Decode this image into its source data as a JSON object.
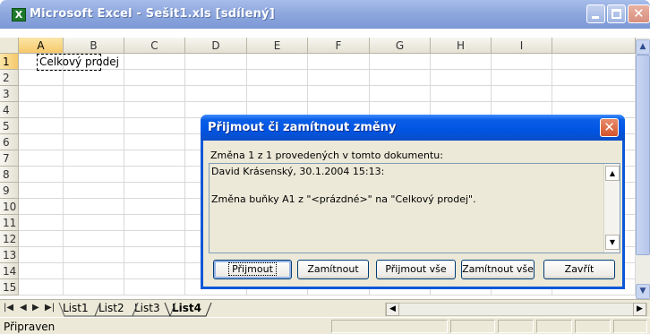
{
  "window": {
    "title": "Microsoft Excel - Sešit1.xls  [sdílený]"
  },
  "grid": {
    "columns": [
      "A",
      "B",
      "C",
      "D",
      "E",
      "F",
      "G",
      "H",
      "I"
    ],
    "rows": [
      "1",
      "2",
      "3",
      "4",
      "5",
      "6",
      "7",
      "8",
      "9",
      "10",
      "11",
      "12",
      "13",
      "14",
      "15"
    ],
    "cell_a1": "Celkový prodej"
  },
  "sheet_tabs": [
    "List1",
    "List2",
    "List3",
    "List4"
  ],
  "active_sheet": "List4",
  "status": {
    "text": "Připraven"
  },
  "dialog": {
    "title": "Přijmout či zamítnout změny",
    "info": "Změna 1 z 1 provedených v tomto dokumentu:",
    "meta": "David Krásenský, 30.1.2004 15:13:",
    "change_text": "Změna buňky A1 z \"<prázdné>\" na \"Celkový prodej\".",
    "buttons": {
      "accept": "Přijmout",
      "reject": "Zamítnout",
      "accept_all": "Přijmout vše",
      "reject_all": "Zamítnout vše",
      "close": "Zavřít"
    }
  },
  "colors": {
    "titlebar": "#8fa8de",
    "dialog_titlebar": "#0054e3",
    "header_active": "#f6c86a",
    "chrome": "#ece9d8"
  }
}
